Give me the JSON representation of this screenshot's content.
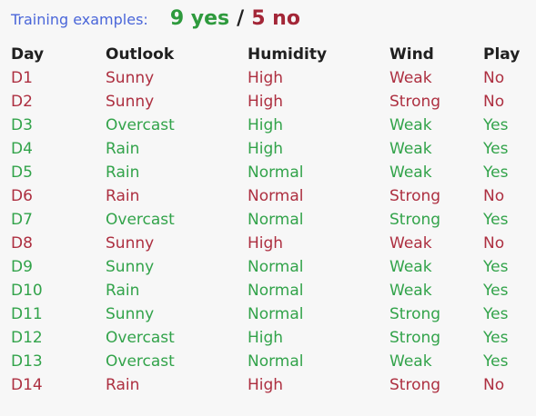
{
  "header": {
    "label": "Training examples:",
    "yes_text": "9 yes",
    "separator": "/",
    "no_text": "5 no"
  },
  "table": {
    "columns": [
      "Day",
      "Outlook",
      "Humidity",
      "Wind",
      "Play"
    ],
    "rows": [
      [
        "D1",
        "Sunny",
        "High",
        "Weak",
        "No"
      ],
      [
        "D2",
        "Sunny",
        "High",
        "Strong",
        "No"
      ],
      [
        "D3",
        "Overcast",
        "High",
        "Weak",
        "Yes"
      ],
      [
        "D4",
        "Rain",
        "High",
        "Weak",
        "Yes"
      ],
      [
        "D5",
        "Rain",
        "Normal",
        "Weak",
        "Yes"
      ],
      [
        "D6",
        "Rain",
        "Normal",
        "Strong",
        "No"
      ],
      [
        "D7",
        "Overcast",
        "Normal",
        "Strong",
        "Yes"
      ],
      [
        "D8",
        "Sunny",
        "High",
        "Weak",
        "No"
      ],
      [
        "D9",
        "Sunny",
        "Normal",
        "Weak",
        "Yes"
      ],
      [
        "D10",
        "Rain",
        "Normal",
        "Weak",
        "Yes"
      ],
      [
        "D11",
        "Sunny",
        "Normal",
        "Strong",
        "Yes"
      ],
      [
        "D12",
        "Overcast",
        "High",
        "Strong",
        "Yes"
      ],
      [
        "D13",
        "Overcast",
        "Normal",
        "Weak",
        "Yes"
      ],
      [
        "D14",
        "Rain",
        "High",
        "Strong",
        "No"
      ]
    ]
  },
  "colors": {
    "label": "#4a66d9",
    "yes": "#32a34a",
    "no": "#ad2f40",
    "header_text": "#202020",
    "background": "#f7f7f7"
  }
}
